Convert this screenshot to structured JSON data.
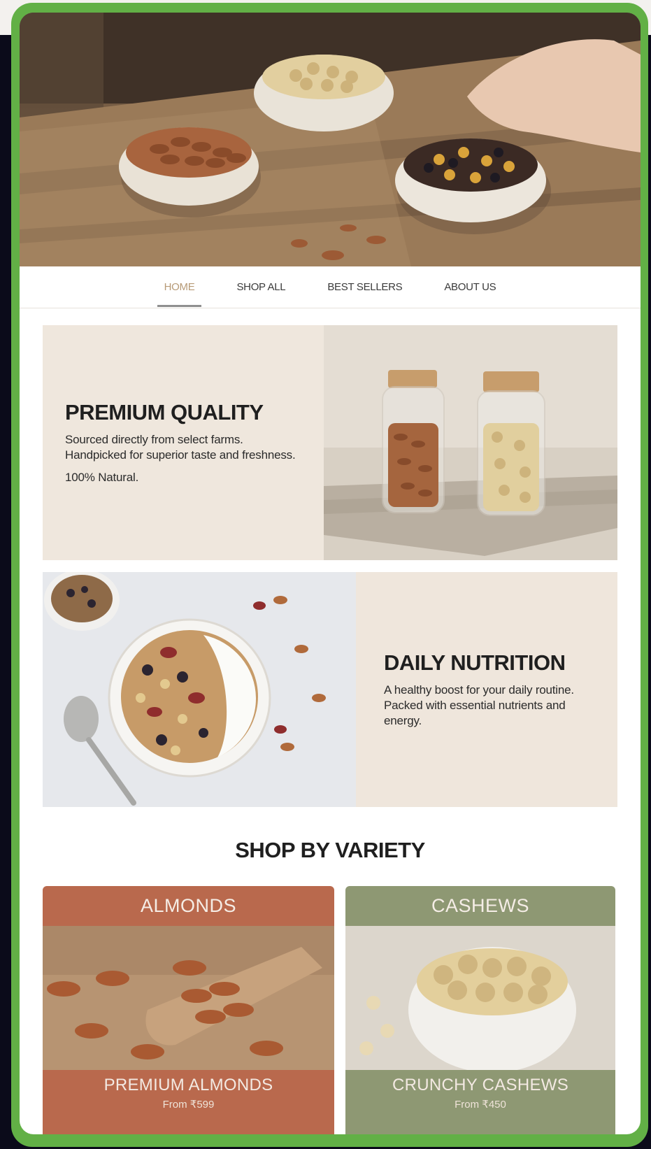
{
  "nav": {
    "items": [
      {
        "label": "HOME",
        "active": true
      },
      {
        "label": "SHOP ALL",
        "active": false
      },
      {
        "label": "BEST SELLERS",
        "active": false
      },
      {
        "label": "ABOUT US",
        "active": false
      }
    ]
  },
  "features": [
    {
      "title": "PREMIUM QUALITY",
      "body": "Sourced directly from select farms. Handpicked for superior taste and freshness.",
      "extra": "100% Natural."
    },
    {
      "title": "DAILY NUTRITION",
      "body": "A healthy boost for your daily routine. Packed with essential nutrients and energy."
    }
  ],
  "shop": {
    "title": "SHOP BY VARIETY",
    "cards": [
      {
        "header": "ALMONDS",
        "name": "PREMIUM ALMONDS",
        "price": "From ₹599",
        "color": "#b9694d"
      },
      {
        "header": "CASHEWS",
        "name": "CRUNCHY CASHEWS",
        "price": "From ₹450",
        "color": "#8e9873"
      }
    ]
  },
  "colors": {
    "frame": "#62b046",
    "panel": "#efe7dd",
    "nav_active": "#b79a77"
  }
}
